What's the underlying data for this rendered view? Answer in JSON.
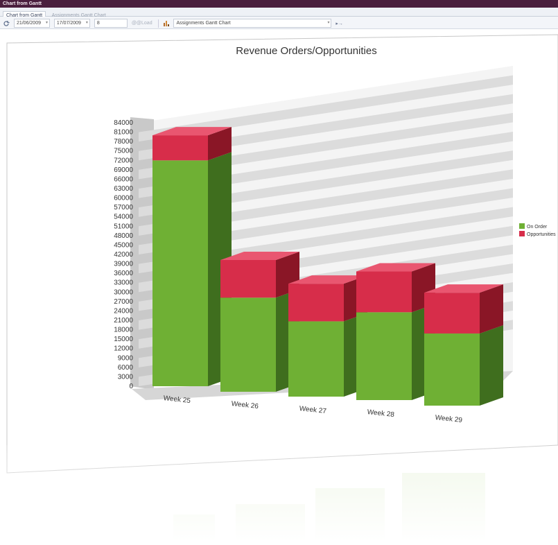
{
  "window": {
    "title": "Chart from Gantt"
  },
  "tabs": [
    {
      "label": "Chart from Gantt",
      "active": true
    },
    {
      "label": "Assignments Gantt Chart",
      "active": false
    }
  ],
  "toolbar": {
    "refresh_icon": "refresh-icon",
    "start_date": "21/06/2009",
    "end_date": "17/07/2009",
    "count_value": "8",
    "button_label": "@@Load",
    "chart_icon": "bar-chart-icon",
    "chart_select": "Assignments Gantt Chart",
    "run_label": "▸→"
  },
  "colors": {
    "green_front": "#6fb034",
    "green_side": "#3f6e1e",
    "green_top": "#8cc552",
    "red_front": "#d72d4a",
    "red_side": "#8a1626",
    "red_top": "#e95670"
  },
  "chart_data": {
    "type": "bar",
    "stacked": true,
    "title": "Revenue Orders/Opportunities",
    "categories": [
      "Week 25",
      "Week 26",
      "Week 27",
      "Week 28",
      "Week 29"
    ],
    "series": [
      {
        "name": "On Order",
        "values": [
          72000,
          30000,
          24000,
          28000,
          23000
        ]
      },
      {
        "name": "Opportunities",
        "values": [
          8000,
          12000,
          12000,
          13000,
          13000
        ]
      }
    ],
    "yticks": [
      0,
      3000,
      6000,
      9000,
      12000,
      15000,
      18000,
      21000,
      24000,
      27000,
      30000,
      33000,
      36000,
      39000,
      42000,
      45000,
      48000,
      51000,
      54000,
      57000,
      60000,
      63000,
      66000,
      69000,
      72000,
      75000,
      78000,
      81000,
      84000
    ],
    "ylim": [
      0,
      84000
    ],
    "grid": true,
    "legend": "right"
  }
}
